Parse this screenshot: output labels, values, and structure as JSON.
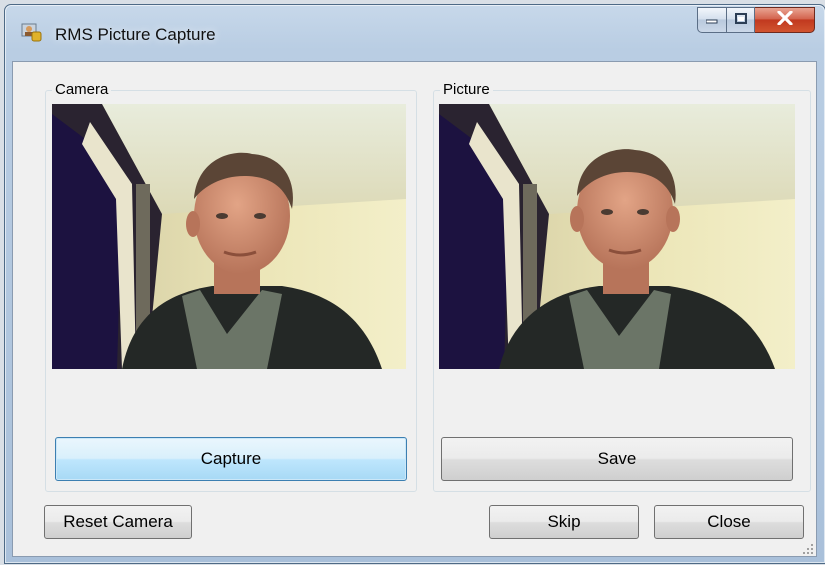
{
  "window": {
    "title": "RMS Picture Capture",
    "icon": "camera-person-icon",
    "controls": {
      "minimize": "minimize-icon",
      "maximize": "maximize-icon",
      "close": "close-icon"
    }
  },
  "camera_panel": {
    "label": "Camera",
    "capture_button": "Capture"
  },
  "picture_panel": {
    "label": "Picture",
    "save_button": "Save"
  },
  "footer": {
    "reset_button": "Reset Camera",
    "skip_button": "Skip",
    "close_button": "Close"
  },
  "colors": {
    "titlebar": "#b9cde3",
    "client_bg": "#f0f0f0",
    "focus_border": "#3c7fb1",
    "close_button": "#c1391f"
  }
}
